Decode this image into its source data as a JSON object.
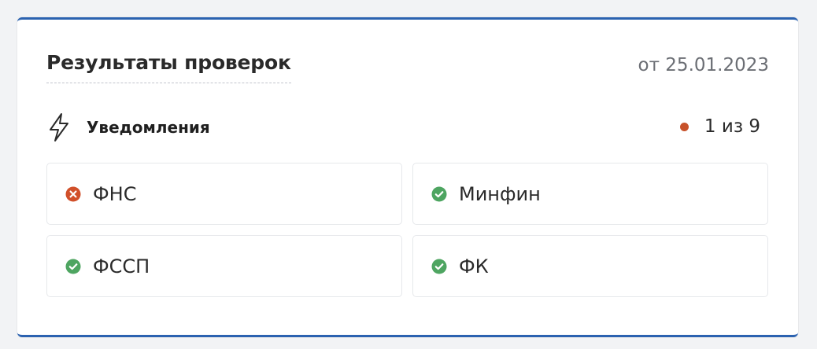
{
  "card": {
    "title": "Результаты проверок",
    "date": "от 25.01.2023"
  },
  "notifications": {
    "icon": "lightning-icon",
    "label": "Уведомления",
    "counter_text": "1 из 9",
    "counter_dot_color": "#c7522a"
  },
  "checks": [
    {
      "label": "ФНС",
      "status": "error",
      "icon": "error-x-icon",
      "color": "#d1502a"
    },
    {
      "label": "Минфин",
      "status": "ok",
      "icon": "check-circle-icon",
      "color": "#4ea561"
    },
    {
      "label": "ФССП",
      "status": "ok",
      "icon": "check-circle-icon",
      "color": "#4ea561"
    },
    {
      "label": "ФК",
      "status": "ok",
      "icon": "check-circle-icon",
      "color": "#4ea561"
    }
  ],
  "colors": {
    "accent_border": "#2b62b0",
    "error": "#d1502a",
    "success": "#4ea561"
  }
}
